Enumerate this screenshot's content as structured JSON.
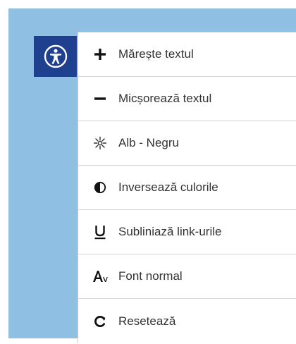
{
  "colors": {
    "backdrop": "#8fc0e4",
    "toggle_bg": "#1f3f8f",
    "panel_bg": "#ffffff",
    "text": "#333333",
    "divider": "#d6d6d6"
  },
  "toolbar": {
    "toggle_icon": "accessibility-icon",
    "items": [
      {
        "label": "Mărește textul",
        "icon": "plus-icon"
      },
      {
        "label": "Micșorează textul",
        "icon": "minus-icon"
      },
      {
        "label": "Alb - Negru",
        "icon": "grayscale-icon"
      },
      {
        "label": "Inversează culorile",
        "icon": "contrast-icon"
      },
      {
        "label": "Subliniază link-urile",
        "icon": "underline-icon"
      },
      {
        "label": "Font normal",
        "icon": "font-icon"
      },
      {
        "label": "Resetează",
        "icon": "reset-icon"
      }
    ]
  }
}
